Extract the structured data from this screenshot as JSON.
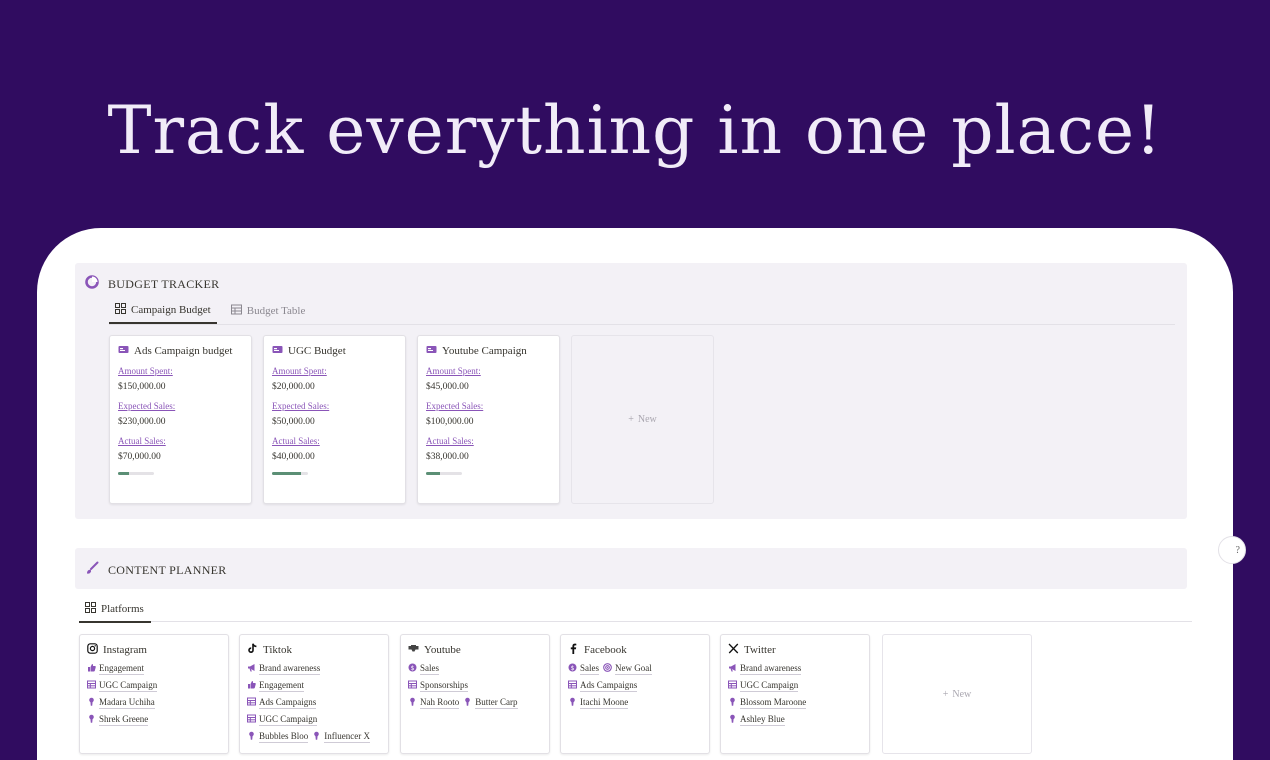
{
  "hero": {
    "title": "Track everything in one place!"
  },
  "budget": {
    "title": "BUDGET TRACKER",
    "tabs": [
      {
        "label": "Campaign Budget"
      },
      {
        "label": "Budget Table"
      }
    ],
    "labels": {
      "spent": "Amount Spent:",
      "expected": "Expected Sales:",
      "actual": "Actual Sales:"
    },
    "cards": [
      {
        "title": "Ads Campaign budget",
        "spent": "$150,000.00",
        "expected": "$230,000.00",
        "actual": "$70,000.00",
        "progress": 0.3
      },
      {
        "title": "UGC Budget",
        "spent": "$20,000.00",
        "expected": "$50,000.00",
        "actual": "$40,000.00",
        "progress": 0.8
      },
      {
        "title": "Youtube Campaign",
        "spent": "$45,000.00",
        "expected": "$100,000.00",
        "actual": "$38,000.00",
        "progress": 0.38
      }
    ],
    "new_label": "New"
  },
  "content": {
    "title": "CONTENT PLANNER",
    "tab": "Platforms",
    "new_label": "New",
    "platforms": [
      {
        "name": "Instagram",
        "icon": "instagram-icon",
        "goals": [
          "Engagement"
        ],
        "campaigns": [
          "UGC Campaign"
        ],
        "people": [
          "Madara Uchiha",
          "Shrek Greene"
        ]
      },
      {
        "name": "Tiktok",
        "icon": "tiktok-icon",
        "goals": [
          "Brand awareness",
          "Engagement"
        ],
        "campaigns": [
          "Ads Campaigns",
          "UGC Campaign"
        ],
        "people": [
          "Bubbles Bloo",
          "Influencer X"
        ]
      },
      {
        "name": "Youtube",
        "icon": "youtube-icon",
        "goals": [
          "Sales"
        ],
        "campaigns": [
          "Sponsorships"
        ],
        "people": [
          "Nah Rooto",
          "Butter Carp"
        ]
      },
      {
        "name": "Facebook",
        "icon": "facebook-icon",
        "goals": [
          "Sales",
          "New Goal"
        ],
        "campaigns": [
          "Ads Campaigns"
        ],
        "people": [
          "Itachi Moone"
        ]
      },
      {
        "name": "Twitter",
        "icon": "x-twitter-icon",
        "goals": [
          "Brand awareness"
        ],
        "campaigns": [
          "UGC Campaign"
        ],
        "people": [
          "Blossom Maroone",
          "Ashley Blue"
        ]
      }
    ]
  },
  "colors": {
    "background": "#300c60",
    "accent": "#8a55b8",
    "progress": "#5b8f75"
  }
}
